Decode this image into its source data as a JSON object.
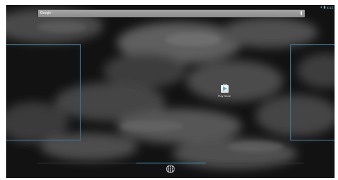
{
  "status_bar": {
    "icons": [
      "wifi-icon",
      "battery-icon"
    ],
    "time": "6:15"
  },
  "search": {
    "label": "Google",
    "mic_icon": "microphone-icon"
  },
  "desktop": {
    "app": {
      "label": "Play Store",
      "icon": "play-store-icon"
    }
  },
  "navigation": {
    "all_apps_icon": "all-apps-icon"
  },
  "colors": {
    "accent": "#47a7d2",
    "frame": "#3f6f8a",
    "search_bar": "#999999"
  }
}
